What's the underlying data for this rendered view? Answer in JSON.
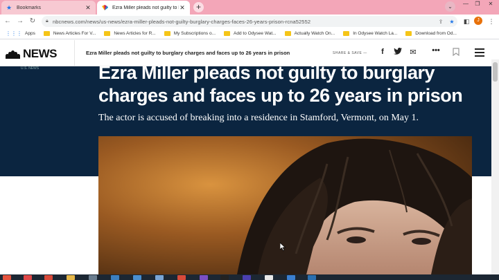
{
  "browser": {
    "tabs": [
      {
        "label": "Bookmarks",
        "icon": "star-icon",
        "active": false
      },
      {
        "label": "Ezra Miller pleads not guilty to b",
        "icon": "nbc-favicon",
        "active": true
      }
    ],
    "new_tab": "+",
    "url": "nbcnews.com/news/us-news/ezra-miller-pleads-not-guilty-burglary-charges-faces-26-years-prison-rcna52552",
    "profile_initial": "J",
    "bookmarks": [
      {
        "label": "Apps",
        "type": "apps"
      },
      {
        "label": "News Articles For V...",
        "type": "folder"
      },
      {
        "label": "News Articles for R...",
        "type": "folder"
      },
      {
        "label": "My Subscriptions o...",
        "type": "folder"
      },
      {
        "label": "Add to Odysee Wat...",
        "type": "folder"
      },
      {
        "label": "Actually Watch On...",
        "type": "folder"
      },
      {
        "label": "In Odysee Watch La...",
        "type": "folder"
      },
      {
        "label": "Download from Od...",
        "type": "folder"
      }
    ]
  },
  "site": {
    "logo_text": "NEWS",
    "header_title": "Ezra Miller pleads not guilty to burglary charges and faces up to 26 years in prison",
    "share_label": "SHARE & SAVE —",
    "kicker": "U.S. NEWS",
    "headline": "Ezra Miller pleads not guilty to burglary charges and faces up to 26 years in prison",
    "dek": "The actor is accused of breaking into a residence in Stamford, Vermont, on May 1."
  },
  "colors": {
    "tabbar": "#f3a6b8",
    "hero_bg": "#0b2540",
    "accent": "#1a73e8"
  }
}
